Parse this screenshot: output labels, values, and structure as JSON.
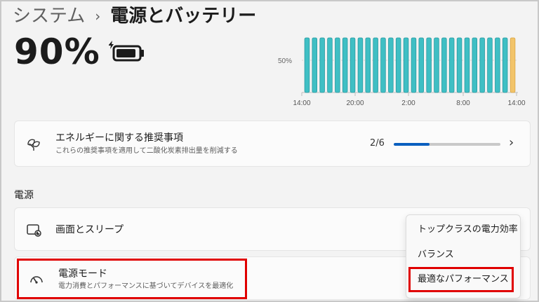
{
  "breadcrumb": {
    "parent": "システム",
    "separator": "›",
    "current": "電源とバッテリー"
  },
  "battery": {
    "percent": "90%",
    "level": 0.9,
    "icon": "battery-icon"
  },
  "chart_data": {
    "type": "bar",
    "y_tick_label": "50%",
    "x_tick_labels": [
      "14:00",
      "20:00",
      "2:00",
      "8:00",
      "14:00"
    ],
    "bar_count": 28,
    "values": [
      100,
      100,
      100,
      100,
      100,
      100,
      100,
      100,
      100,
      100,
      100,
      100,
      100,
      100,
      100,
      100,
      100,
      100,
      100,
      100,
      100,
      100,
      100,
      100,
      100,
      100,
      100,
      100
    ],
    "ylim": [
      0,
      100
    ],
    "colors": {
      "normal": "#3fbfc4",
      "normal_outline": "#2a9aa1",
      "last": "#f2c46a",
      "last_outline": "#d9a441"
    },
    "highlight_last": true,
    "grid": true
  },
  "recommendations": {
    "icon": "leaf-icon",
    "title": "エネルギーに関する推奨事項",
    "subtitle": "これらの推奨事項を適用して二酸化炭素排出量を削減する",
    "count": "2/6",
    "progress": 0.3333,
    "chevron": "›",
    "accent": "#0a5fbf"
  },
  "power_section": {
    "label": "電源"
  },
  "screen_sleep": {
    "icon": "screen-sleep-icon",
    "title": "画面とスリープ"
  },
  "power_mode": {
    "icon": "power-mode-icon",
    "title": "電源モード",
    "subtitle": "電力消費とパフォーマンスに基づいてデバイスを最適化"
  },
  "power_mode_menu": {
    "options": [
      "トップクラスの電力効率",
      "バランス",
      "最適なパフォーマンス"
    ],
    "selected_index": 2
  },
  "highlight_color": "#e00000"
}
